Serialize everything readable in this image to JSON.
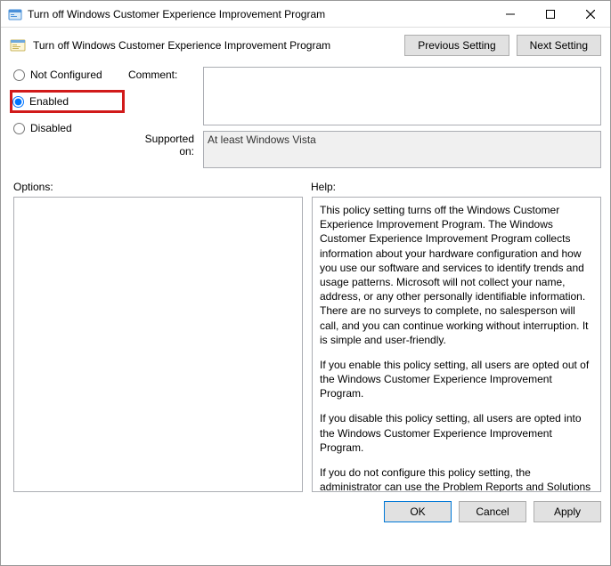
{
  "window": {
    "title": "Turn off Windows Customer Experience Improvement Program"
  },
  "header": {
    "label": "Turn off Windows Customer Experience Improvement Program",
    "prev_btn": "Previous Setting",
    "next_btn": "Next Setting"
  },
  "state": {
    "not_configured": "Not Configured",
    "enabled": "Enabled",
    "disabled": "Disabled",
    "selected": "enabled"
  },
  "fields": {
    "comment_label": "Comment:",
    "comment_value": "",
    "supported_label": "Supported on:",
    "supported_value": "At least Windows Vista"
  },
  "sections": {
    "options_label": "Options:",
    "help_label": "Help:"
  },
  "options_content": "",
  "help": {
    "p1": "This policy setting turns off the Windows Customer Experience Improvement Program. The Windows Customer Experience Improvement Program collects information about your hardware configuration and how you use our software and services to identify trends and usage patterns. Microsoft will not collect your name, address, or any other personally identifiable information. There are no surveys to complete, no salesperson will call, and you can continue working without interruption. It is simple and user-friendly.",
    "p2": "If you enable this policy setting, all users are opted out of the Windows Customer Experience Improvement Program.",
    "p3": "If you disable this policy setting, all users are opted into the Windows Customer Experience Improvement Program.",
    "p4": "If you do not configure this policy setting, the administrator can use the Problem Reports and Solutions component in Control Panel to enable Windows Customer Experience Improvement Program for all users."
  },
  "footer": {
    "ok": "OK",
    "cancel": "Cancel",
    "apply": "Apply"
  }
}
